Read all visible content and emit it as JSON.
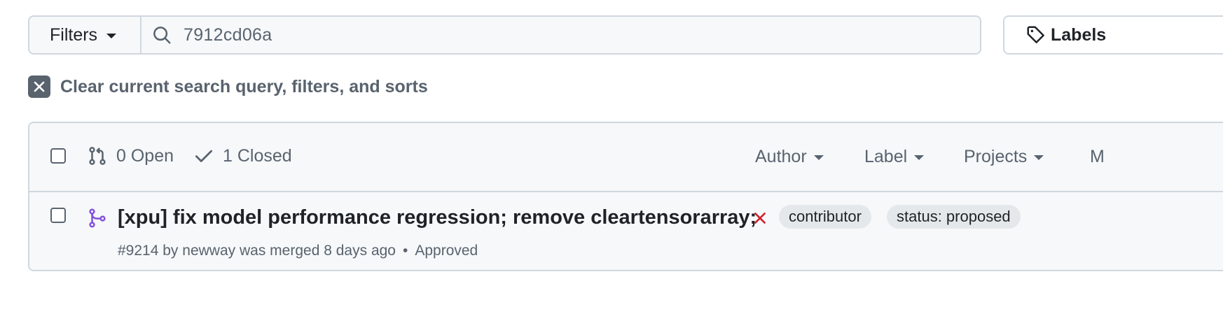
{
  "search": {
    "filters_label": "Filters",
    "query": "7912cd06a"
  },
  "toolbar": {
    "labels_label": "Labels"
  },
  "clear": {
    "label": "Clear current search query, filters, and sorts"
  },
  "list_header": {
    "open_label": "0 Open",
    "closed_label": "1 Closed",
    "sorts": [
      "Author",
      "Label",
      "Projects",
      "M"
    ]
  },
  "pull_requests": [
    {
      "title": "[xpu] fix model performance regression; remove cleartensorarray;",
      "status": "failing",
      "labels": [
        "contributor",
        "status: proposed"
      ],
      "number": "#9214",
      "by": "by",
      "author": "newway",
      "state_text": "was merged",
      "time": "8 days ago",
      "separator": "•",
      "review": "Approved"
    }
  ],
  "colors": {
    "merged": "#8250df",
    "failing": "#cf222e",
    "muted": "#59636e",
    "border": "#d0d7de"
  },
  "icons": {
    "search": "search-icon",
    "tag": "tag-icon",
    "clear": "x-icon",
    "open_pr": "git-pull-request-icon",
    "closed": "check-icon",
    "merged": "git-merge-icon",
    "failing": "x-icon"
  }
}
